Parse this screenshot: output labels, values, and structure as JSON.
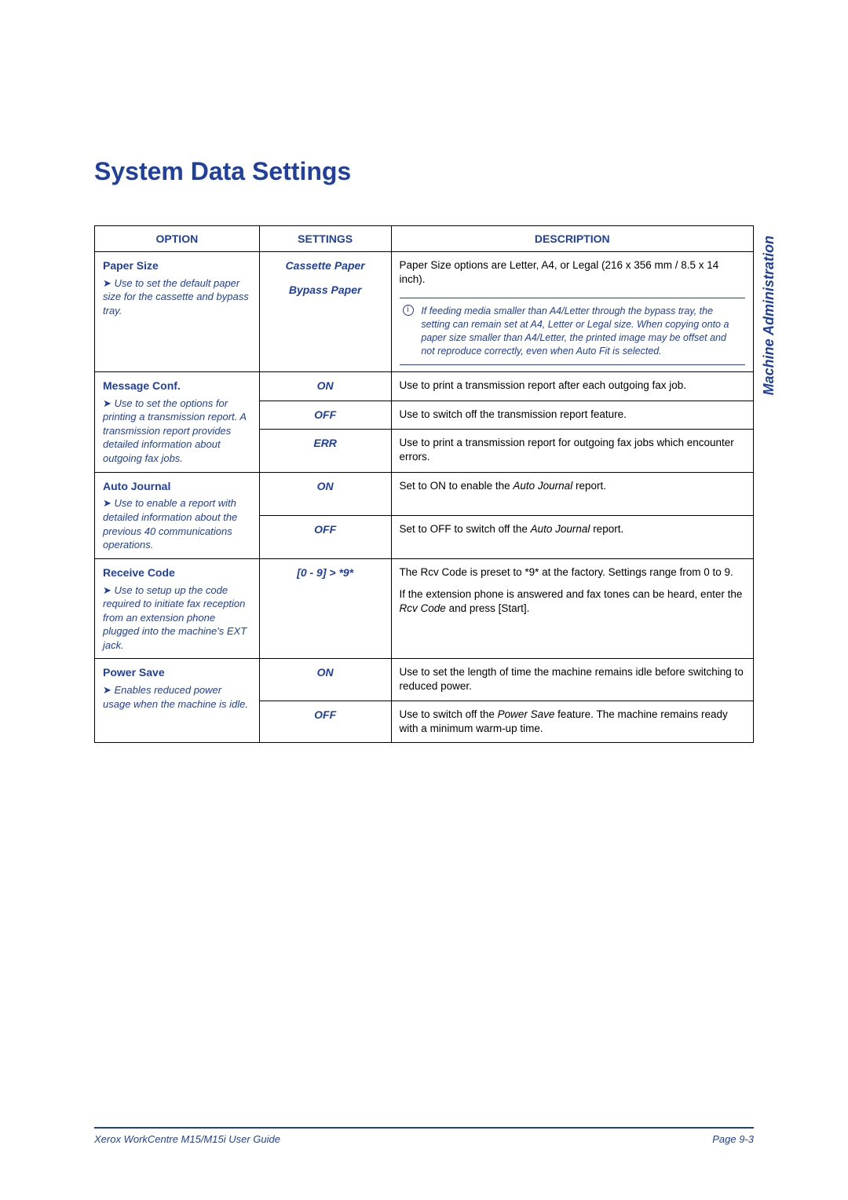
{
  "title": "System Data Settings",
  "side_label": "Machine Administration",
  "headers": {
    "option": "OPTION",
    "settings": "SETTINGS",
    "description": "DESCRIPTION"
  },
  "rows": {
    "paper_size": {
      "name": "Paper Size",
      "note": "Use to set the default paper size for the cassette and bypass tray.",
      "settings": {
        "cassette": "Cassette Paper",
        "bypass": "Bypass Paper"
      },
      "desc": "Paper Size options are Letter, A4, or Legal (216 x 356 mm / 8.5 x 14 inch).",
      "info": "If feeding media smaller than A4/Letter through the bypass tray, the setting can remain set at A4, Letter or Legal size.\nWhen copying onto a paper size smaller than A4/Letter, the printed image may be offset and not reproduce correctly, even when Auto Fit is selected."
    },
    "message_conf": {
      "name": "Message Conf.",
      "note": "Use to set the options for printing a transmission report. A transmission report provides detailed information about outgoing fax jobs.",
      "on": {
        "label": "ON",
        "desc": "Use to print a transmission report after each outgoing fax job."
      },
      "off": {
        "label": "OFF",
        "desc": "Use to switch off the transmission report feature."
      },
      "err": {
        "label": "ERR",
        "desc": "Use to print a transmission report for outgoing fax jobs which encounter errors."
      }
    },
    "auto_journal": {
      "name": "Auto Journal",
      "note": "Use to enable a report with detailed information about the previous 40 communications operations.",
      "on": {
        "label": "ON",
        "desc_pre": "Set to ON to enable the ",
        "desc_em": "Auto Journal",
        "desc_post": " report."
      },
      "off": {
        "label": "OFF",
        "desc_pre": "Set to OFF to switch off the ",
        "desc_em": "Auto Journal",
        "desc_post": " report."
      }
    },
    "receive_code": {
      "name": "Receive Code",
      "note": "Use to setup up the code required to initiate fax reception from an extension phone plugged into the machine's EXT jack.",
      "setting": "[0 - 9] > *9*",
      "desc_p1": "The Rcv Code is preset to *9* at the factory. Settings range from 0 to 9.",
      "desc_p2_pre": "If the extension phone is answered and fax tones can be heard, enter the ",
      "desc_p2_em": "Rcv Code",
      "desc_p2_post": " and press [Start]."
    },
    "power_save": {
      "name": "Power Save",
      "note": "Enables reduced power usage when the machine is idle.",
      "on": {
        "label": "ON",
        "desc": "Use to set the length of time the machine remains idle before switching to reduced power."
      },
      "off": {
        "label": "OFF",
        "desc_pre": "Use to switch off the ",
        "desc_em": "Power Save",
        "desc_post": " feature. The machine remains ready with a minimum warm-up time."
      }
    }
  },
  "footer": {
    "left": "Xerox WorkCentre M15/M15i User Guide",
    "right": "Page 9-3"
  }
}
